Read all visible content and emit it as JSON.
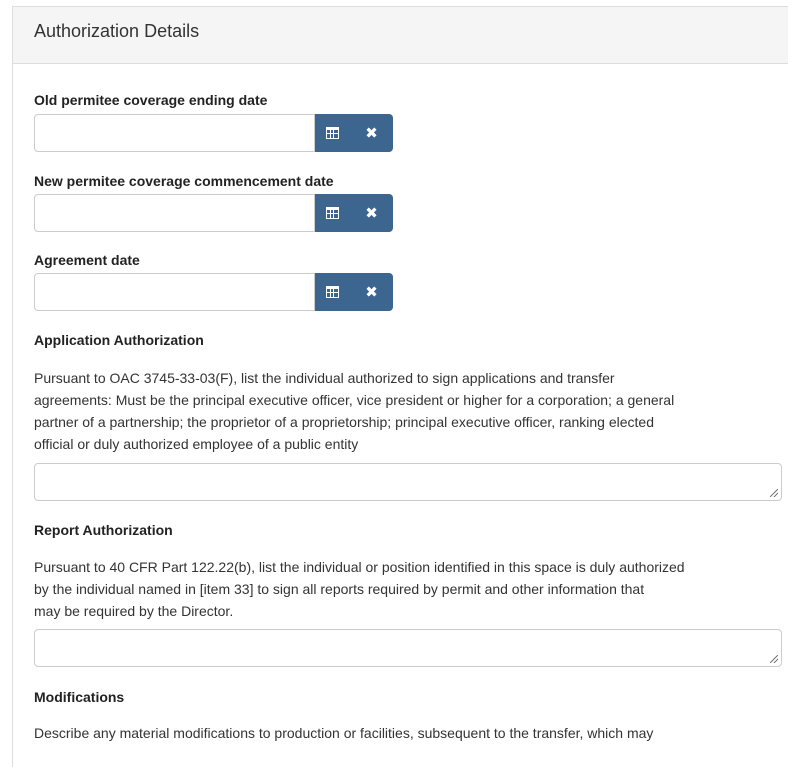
{
  "panel": {
    "title": "Authorization Details"
  },
  "fields": {
    "old_coverage": {
      "label": "Old permitee coverage ending date",
      "value": ""
    },
    "new_coverage": {
      "label": "New permitee coverage commencement date",
      "value": ""
    },
    "agreement": {
      "label": "Agreement date",
      "value": ""
    }
  },
  "icons": {
    "calendar": "calendar-icon",
    "clear": "times-icon"
  },
  "colors": {
    "button": "#3c6690",
    "heading_bg": "#f5f5f5",
    "border": "#dddddd"
  },
  "application_authorization": {
    "title": "Application Authorization",
    "lines": [
      "Pursuant to OAC 3745-33-03(F), list the individual authorized to sign applications and transfer",
      "agreements: Must be the principal executive officer, vice president or higher for a corporation; a general",
      "partner of a partnership; the proprietor of a proprietorship; principal executive officer, ranking elected",
      "official or duly authorized employee of a public entity"
    ],
    "value": ""
  },
  "report_authorization": {
    "title": "Report Authorization",
    "lines": [
      "Pursuant to 40 CFR Part 122.22(b), list the individual or position identified in this space is duly authorized",
      "by the individual named in [item 33] to sign all reports required by permit and other information that",
      "may be required by the Director."
    ],
    "value": ""
  },
  "modifications": {
    "title": "Modifications",
    "lines": [
      "Describe any material modifications to production or facilities, subsequent to the transfer, which may"
    ]
  }
}
